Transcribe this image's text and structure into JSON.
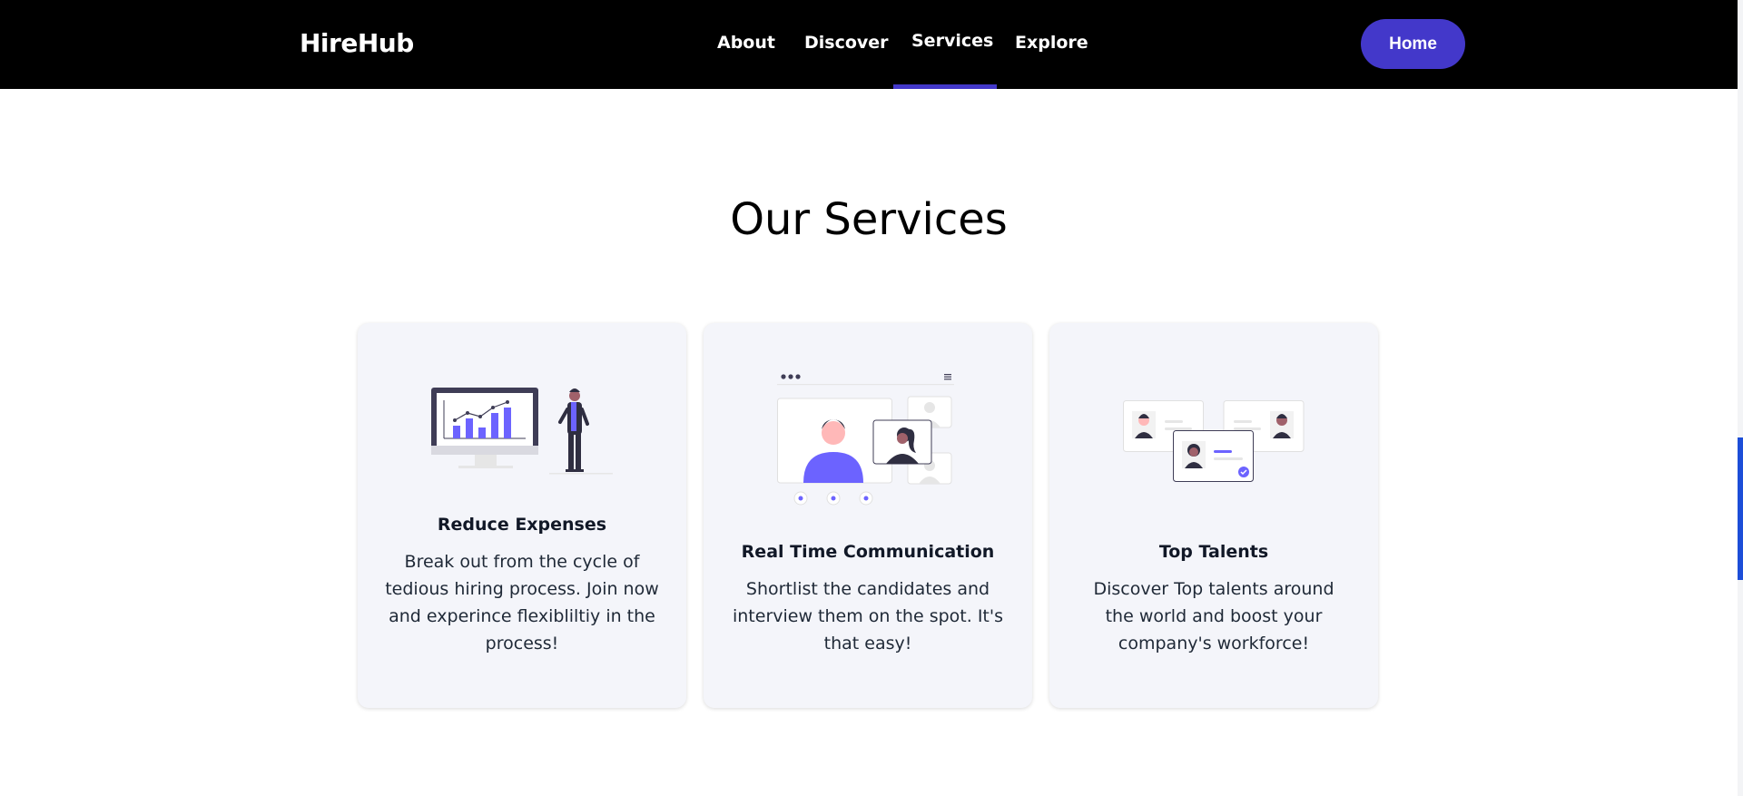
{
  "navbar": {
    "brand": "HireHub",
    "links": [
      {
        "label": "About"
      },
      {
        "label": "Discover"
      },
      {
        "label": "Services",
        "active": true
      },
      {
        "label": "Explore"
      }
    ],
    "home_button": "Home"
  },
  "services": {
    "title": "Our Services",
    "cards": [
      {
        "illustration": "analytics-presentation-illustration",
        "title": "Reduce Expenses",
        "text": "Break out from the cycle of tedious hiring process. Join now and experince flexibliltiy in the process!"
      },
      {
        "illustration": "video-call-illustration",
        "title": "Real Time Communication",
        "text": "Shortlist the candidates and interview them on the spot. It's that easy!"
      },
      {
        "illustration": "talent-profiles-illustration",
        "title": "Top Talents",
        "text": "Discover Top talents around the world and boost your company's workforce!"
      }
    ]
  },
  "colors": {
    "accent": "#4338ca",
    "illustration_purple": "#6c63ff",
    "navbar_background": "#000000",
    "card_background": "#f4f5fa",
    "scrollbar_thumb": "#1d4ed8"
  }
}
